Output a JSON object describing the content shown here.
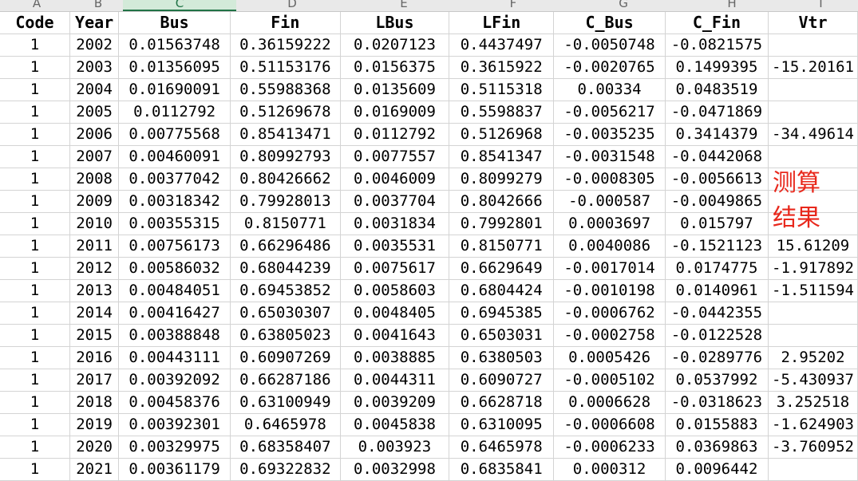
{
  "sheet": {
    "column_letters": [
      "A",
      "B",
      "C",
      "D",
      "E",
      "F",
      "G",
      "H",
      "I"
    ],
    "selected_column": "C",
    "headers": [
      "Code",
      "Year",
      "Bus",
      "Fin",
      "LBus",
      "LFin",
      "C_Bus",
      "C_Fin",
      "Vtr"
    ],
    "rows": [
      [
        "1",
        "2002",
        "0.01563748",
        "0.36159222",
        "0.0207123",
        "0.4437497",
        "-0.0050748",
        "-0.0821575",
        ""
      ],
      [
        "1",
        "2003",
        "0.01356095",
        "0.51153176",
        "0.0156375",
        "0.3615922",
        "-0.0020765",
        "0.1499395",
        "-15.20161"
      ],
      [
        "1",
        "2004",
        "0.01690091",
        "0.55988368",
        "0.0135609",
        "0.5115318",
        "0.00334",
        "0.0483519",
        ""
      ],
      [
        "1",
        "2005",
        "0.0112792",
        "0.51269678",
        "0.0169009",
        "0.5598837",
        "-0.0056217",
        "-0.0471869",
        ""
      ],
      [
        "1",
        "2006",
        "0.00775568",
        "0.85413471",
        "0.0112792",
        "0.5126968",
        "-0.0035235",
        "0.3414379",
        "-34.49614"
      ],
      [
        "1",
        "2007",
        "0.00460091",
        "0.80992793",
        "0.0077557",
        "0.8541347",
        "-0.0031548",
        "-0.0442068",
        ""
      ],
      [
        "1",
        "2008",
        "0.00377042",
        "0.80426662",
        "0.0046009",
        "0.8099279",
        "-0.0008305",
        "-0.0056613",
        ""
      ],
      [
        "1",
        "2009",
        "0.00318342",
        "0.79928013",
        "0.0037704",
        "0.8042666",
        "-0.000587",
        "-0.0049865",
        ""
      ],
      [
        "1",
        "2010",
        "0.00355315",
        "0.8150771",
        "0.0031834",
        "0.7992801",
        "0.0003697",
        "0.015797",
        ""
      ],
      [
        "1",
        "2011",
        "0.00756173",
        "0.66296486",
        "0.0035531",
        "0.8150771",
        "0.0040086",
        "-0.1521123",
        "15.61209"
      ],
      [
        "1",
        "2012",
        "0.00586032",
        "0.68044239",
        "0.0075617",
        "0.6629649",
        "-0.0017014",
        "0.0174775",
        "-1.917892"
      ],
      [
        "1",
        "2013",
        "0.00484051",
        "0.69453852",
        "0.0058603",
        "0.6804424",
        "-0.0010198",
        "0.0140961",
        "-1.511594"
      ],
      [
        "1",
        "2014",
        "0.00416427",
        "0.65030307",
        "0.0048405",
        "0.6945385",
        "-0.0006762",
        "-0.0442355",
        ""
      ],
      [
        "1",
        "2015",
        "0.00388848",
        "0.63805023",
        "0.0041643",
        "0.6503031",
        "-0.0002758",
        "-0.0122528",
        ""
      ],
      [
        "1",
        "2016",
        "0.00443111",
        "0.60907269",
        "0.0038885",
        "0.6380503",
        "0.0005426",
        "-0.0289776",
        "2.95202"
      ],
      [
        "1",
        "2017",
        "0.00392092",
        "0.66287186",
        "0.0044311",
        "0.6090727",
        "-0.0005102",
        "0.0537992",
        "-5.430937"
      ],
      [
        "1",
        "2018",
        "0.00458376",
        "0.63100949",
        "0.0039209",
        "0.6628718",
        "0.0006628",
        "-0.0318623",
        "3.252518"
      ],
      [
        "1",
        "2019",
        "0.00392301",
        "0.6465978",
        "0.0045838",
        "0.6310095",
        "-0.0006608",
        "0.0155883",
        "-1.624903"
      ],
      [
        "1",
        "2020",
        "0.00329975",
        "0.68358407",
        "0.003923",
        "0.6465978",
        "-0.0006233",
        "0.0369863",
        "-3.760952"
      ],
      [
        "1",
        "2021",
        "0.00361179",
        "0.69322832",
        "0.0032998",
        "0.6835841",
        "0.000312",
        "0.0096442",
        ""
      ]
    ]
  },
  "annotation": {
    "line1": "测算",
    "line2": "结果",
    "color": "#e8281c"
  }
}
